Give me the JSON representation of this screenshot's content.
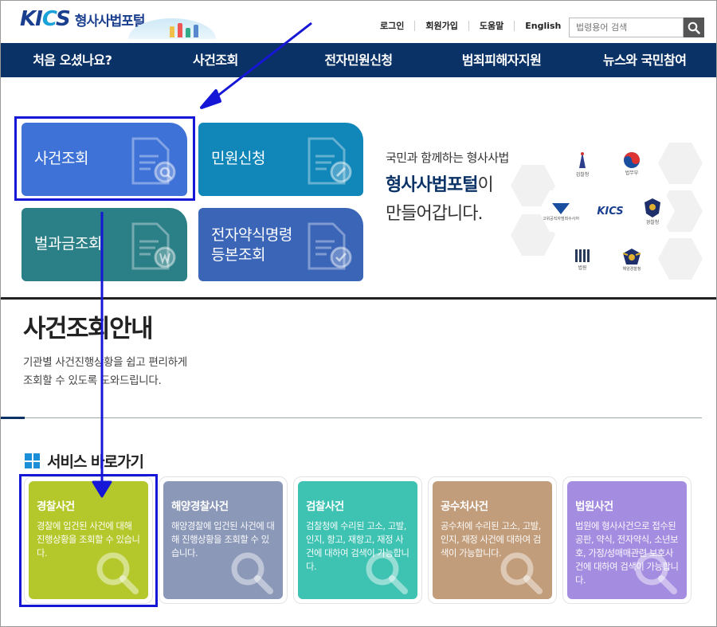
{
  "header": {
    "logo_text": "KICS",
    "site_name": "형사사법포털",
    "util_links": [
      "로그인",
      "회원가입",
      "도움말",
      "English"
    ],
    "search_placeholder": "법령용어 검색"
  },
  "nav": {
    "items": [
      "처음 오셨나요?",
      "사건조회",
      "전자민원신청",
      "범죄피해자지원",
      "뉴스와 국민참여"
    ]
  },
  "tiles": [
    {
      "label": "사건조회",
      "color": "#3f72d6"
    },
    {
      "label": "민원신청",
      "color": "#1186b8"
    },
    {
      "label": "벌과금조회",
      "color": "#2b7f86"
    },
    {
      "label_line1": "전자약식명령",
      "label_line2": "등본조회",
      "color": "#3b66b8"
    }
  ],
  "promo": {
    "line1": "국민과 함께하는 형사사법",
    "line2_bold": "형사사법포털",
    "line2_rest": "이",
    "line3": "만들어갑니다.",
    "hex_labels": [
      "KICS",
      "법무부",
      "검찰청",
      "고위공직자범죄수사처",
      "법원",
      "경찰청",
      "해양경찰청"
    ]
  },
  "section": {
    "title": "사건조회안내",
    "desc_line1": "기관별 사건진행상황을 쉽고 편리하게",
    "desc_line2": "조회할 수 있도록 도와드립니다.",
    "service_title": "서비스 바로가기"
  },
  "cards": [
    {
      "title": "경찰사건",
      "desc": "경찰에 입건된 사건에 대해 진행상황을 조회할 수 있습니다.",
      "color": "#b4c82c"
    },
    {
      "title": "해양경찰사건",
      "desc": "해양경찰에 입건된 사건에 대해 진행상황을 조회할 수 있습니다.",
      "color": "#8b98b8"
    },
    {
      "title": "검찰사건",
      "desc": "검찰청에 수리된 고소, 고발, 인지, 항고, 재항고, 재정 사건에 대하여 검색이 가능합니다.",
      "color": "#3ec2b2"
    },
    {
      "title": "공수처사건",
      "desc": "공수처에 수리된 고소, 고발, 인지, 재정 사건에 대하여 검색이 가능합니다.",
      "color": "#c29d7b"
    },
    {
      "title": "법원사건",
      "desc": "법원에 형사사건으로 접수된 공판, 약식, 전자약식, 소년보호, 가정/성매매관련 보호사건에 대하여 검색이 가능합니다.",
      "color": "#a48ce0"
    }
  ],
  "annotation_color": "#1616d6"
}
